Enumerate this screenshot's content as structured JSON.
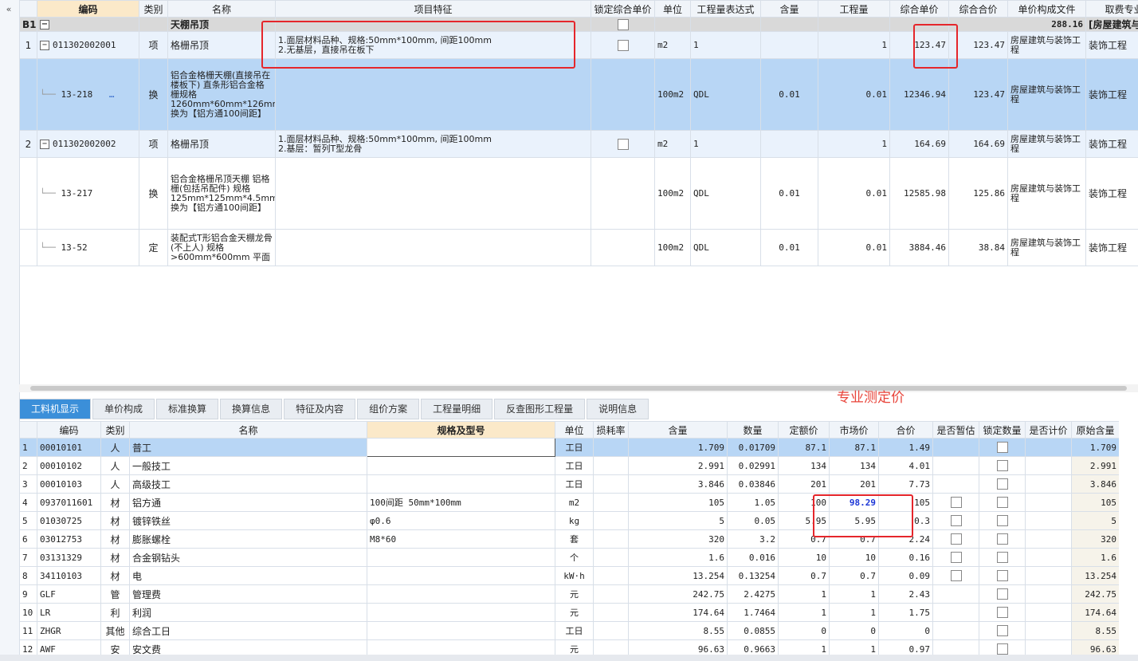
{
  "top_grid": {
    "headers": [
      "",
      "编码",
      "类别",
      "名称",
      "项目特征",
      "锁定综合单价",
      "单位",
      "工程量表达式",
      "含量",
      "工程量",
      "综合单价",
      "综合合价",
      "单价构成文件",
      "取费专业"
    ],
    "section": {
      "index": "B1",
      "name": "天棚吊顶",
      "total": "288.16",
      "file": "[房屋建筑与…"
    },
    "rows": [
      {
        "index": "1",
        "code": "011302002001",
        "type": "项",
        "name": "格栅吊顶",
        "feature": "1.面层材料品种、规格:50mm*100mm, 间距100mm\n2.无基层，直接吊在板下",
        "unit": "m2",
        "expr": "1",
        "content": "",
        "qty": "1",
        "unit_price": "123.47",
        "total": "123.47",
        "file": "房屋建筑与装饰工程",
        "major": "装饰工程"
      },
      {
        "index": "",
        "code": "13-218",
        "type": "换",
        "name": "铝合金格栅天棚(直接吊在楼板下) 直条形铝合金格栅规格 1260mm*60mm*126mm 换为【铝方通100间距】",
        "feature": "",
        "unit": "100m2",
        "expr": "QDL",
        "content": "0.01",
        "qty": "0.01",
        "unit_price": "12346.94",
        "total": "123.47",
        "file": "房屋建筑与装饰工程",
        "major": "装饰工程"
      },
      {
        "index": "2",
        "code": "011302002002",
        "type": "项",
        "name": "格栅吊顶",
        "feature": "1.面层材料品种、规格:50mm*100mm, 间距100mm\n2.基层：暂列T型龙骨",
        "unit": "m2",
        "expr": "1",
        "content": "",
        "qty": "1",
        "unit_price": "164.69",
        "total": "164.69",
        "file": "房屋建筑与装饰工程",
        "major": "装饰工程"
      },
      {
        "index": "",
        "code": "13-217",
        "type": "换",
        "name": "铝合金格栅吊顶天棚 铝格栅(包括吊配件) 规格 125mm*125mm*4.5mm 换为【铝方通100间距】",
        "feature": "",
        "unit": "100m2",
        "expr": "QDL",
        "content": "0.01",
        "qty": "0.01",
        "unit_price": "12585.98",
        "total": "125.86",
        "file": "房屋建筑与装饰工程",
        "major": "装饰工程"
      },
      {
        "index": "",
        "code": "13-52",
        "type": "定",
        "name": "装配式T形铝合金天棚龙骨(不上人) 规格 >600mm*600mm 平面",
        "feature": "",
        "unit": "100m2",
        "expr": "QDL",
        "content": "0.01",
        "qty": "0.01",
        "unit_price": "3884.46",
        "total": "38.84",
        "file": "房屋建筑与装饰工程",
        "major": "装饰工程"
      }
    ]
  },
  "annotation": {
    "label": "专业测定价"
  },
  "tabs": [
    "工料机显示",
    "单价构成",
    "标准换算",
    "换算信息",
    "特征及内容",
    "组价方案",
    "工程量明细",
    "反查图形工程量",
    "说明信息"
  ],
  "bottom_grid": {
    "headers": [
      "",
      "编码",
      "类别",
      "名称",
      "规格及型号",
      "单位",
      "损耗率",
      "含量",
      "数量",
      "定额价",
      "市场价",
      "合价",
      "是否暂估",
      "锁定数量",
      "是否计价",
      "原始含量"
    ],
    "rows": [
      {
        "i": "1",
        "code": "00010101",
        "type": "人",
        "name": "普工",
        "spec": "",
        "unit": "工日",
        "loss": "",
        "content": "1.709",
        "qty": "0.01709",
        "quota": "87.1",
        "market": "87.1",
        "total": "1.49",
        "est": false,
        "lock": true,
        "orig": "1.709"
      },
      {
        "i": "2",
        "code": "00010102",
        "type": "人",
        "name": "一般技工",
        "spec": "",
        "unit": "工日",
        "loss": "",
        "content": "2.991",
        "qty": "0.02991",
        "quota": "134",
        "market": "134",
        "total": "4.01",
        "est": false,
        "lock": true,
        "orig": "2.991"
      },
      {
        "i": "3",
        "code": "00010103",
        "type": "人",
        "name": "高级技工",
        "spec": "",
        "unit": "工日",
        "loss": "",
        "content": "3.846",
        "qty": "0.03846",
        "quota": "201",
        "market": "201",
        "total": "7.73",
        "est": false,
        "lock": true,
        "orig": "3.846"
      },
      {
        "i": "4",
        "code": "0937011601",
        "type": "材",
        "name": "铝方通",
        "spec": "100间距  50mm*100mm",
        "unit": "m2",
        "loss": "",
        "content": "105",
        "qty": "1.05",
        "quota": "100",
        "market": "98.29",
        "total": "105",
        "est": true,
        "lock": true,
        "orig": "105"
      },
      {
        "i": "5",
        "code": "01030725",
        "type": "材",
        "name": "镀锌铁丝",
        "spec": "φ0.6",
        "unit": "kg",
        "loss": "",
        "content": "5",
        "qty": "0.05",
        "quota": "5.95",
        "market": "5.95",
        "total": "0.3",
        "est": true,
        "lock": true,
        "orig": "5"
      },
      {
        "i": "6",
        "code": "03012753",
        "type": "材",
        "name": "膨胀螺栓",
        "spec": "M8*60",
        "unit": "套",
        "loss": "",
        "content": "320",
        "qty": "3.2",
        "quota": "0.7",
        "market": "0.7",
        "total": "2.24",
        "est": true,
        "lock": true,
        "orig": "320"
      },
      {
        "i": "7",
        "code": "03131329",
        "type": "材",
        "name": "合金钢钻头",
        "spec": "",
        "unit": "个",
        "loss": "",
        "content": "1.6",
        "qty": "0.016",
        "quota": "10",
        "market": "10",
        "total": "0.16",
        "est": true,
        "lock": true,
        "orig": "1.6"
      },
      {
        "i": "8",
        "code": "34110103",
        "type": "材",
        "name": "电",
        "spec": "",
        "unit": "kW·h",
        "loss": "",
        "content": "13.254",
        "qty": "0.13254",
        "quota": "0.7",
        "market": "0.7",
        "total": "0.09",
        "est": true,
        "lock": true,
        "orig": "13.254"
      },
      {
        "i": "9",
        "code": "GLF",
        "type": "管",
        "name": "管理费",
        "spec": "",
        "unit": "元",
        "loss": "",
        "content": "242.75",
        "qty": "2.4275",
        "quota": "1",
        "market": "1",
        "total": "2.43",
        "est": false,
        "lock": true,
        "orig": "242.75"
      },
      {
        "i": "10",
        "code": "LR",
        "type": "利",
        "name": "利润",
        "spec": "",
        "unit": "元",
        "loss": "",
        "content": "174.64",
        "qty": "1.7464",
        "quota": "1",
        "market": "1",
        "total": "1.75",
        "est": false,
        "lock": true,
        "orig": "174.64"
      },
      {
        "i": "11",
        "code": "ZHGR",
        "type": "其他",
        "name": "综合工日",
        "spec": "",
        "unit": "工日",
        "loss": "",
        "content": "8.55",
        "qty": "0.0855",
        "quota": "0",
        "market": "0",
        "total": "0",
        "est": false,
        "lock": true,
        "orig": "8.55"
      },
      {
        "i": "12",
        "code": "AWF",
        "type": "安",
        "name": "安文费",
        "spec": "",
        "unit": "元",
        "loss": "",
        "content": "96.63",
        "qty": "0.9663",
        "quota": "1",
        "market": "1",
        "total": "0.97",
        "est": false,
        "lock": true,
        "orig": "96.63"
      }
    ]
  }
}
